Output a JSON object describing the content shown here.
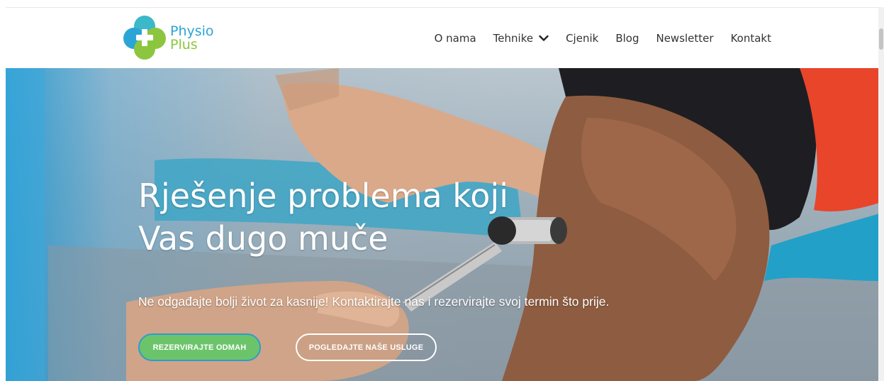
{
  "brand": {
    "line1": "Physio",
    "line2": "Plus",
    "colors": {
      "blue": "#2ba5d6",
      "green": "#8cc63f",
      "teal": "#3bb8c9"
    }
  },
  "nav": {
    "items": [
      {
        "label": "O nama"
      },
      {
        "label": "Tehnike",
        "icon": "chevron-down-icon"
      },
      {
        "label": "Cjenik"
      },
      {
        "label": "Blog"
      },
      {
        "label": "Newsletter"
      },
      {
        "label": "Kontakt"
      }
    ]
  },
  "hero": {
    "title_line1": "Rješenje problema koji",
    "title_line2": "Vas dugo muče",
    "subtitle": "Ne odgađajte bolji život za kasnije! Kontaktirajte nas i rezervirajte svoj termin što prije.",
    "primary_button": "REZERVIRAJTE ODMAH",
    "secondary_button": "POGLEDAJTE NAŠE USLUGE",
    "colors": {
      "primary_button_bg": "#6cc46a",
      "primary_button_border": "#2d9bd2"
    }
  }
}
